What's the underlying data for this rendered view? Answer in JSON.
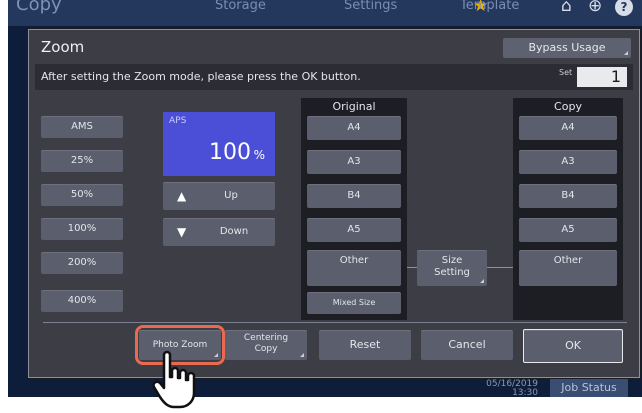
{
  "topbar": {
    "app_title": "Copy",
    "tabs": [
      "Storage",
      "Settings",
      "Template"
    ]
  },
  "dialog": {
    "title": "Zoom",
    "bypass_label": "Bypass Usage",
    "message": "After setting the Zoom mode, please press the OK button.",
    "set_label": "Set",
    "set_value": "1"
  },
  "zoom_buttons": [
    "AMS",
    "25%",
    "50%",
    "100%",
    "200%",
    "400%"
  ],
  "aps": {
    "label": "APS",
    "value": "100",
    "unit": "%"
  },
  "up_label": "Up",
  "down_label": "Down",
  "original": {
    "header": "Original",
    "items": [
      "A4",
      "A3",
      "B4",
      "A5",
      "Other",
      "Mixed Size"
    ]
  },
  "size_setting": {
    "line1": "Size",
    "line2": "Setting"
  },
  "copy": {
    "header": "Copy",
    "items": [
      "A4",
      "A3",
      "B4",
      "A5",
      "Other"
    ]
  },
  "bottom": {
    "photo_zoom": "Photo Zoom",
    "centering_line1": "Centering",
    "centering_line2": "Copy",
    "reset": "Reset",
    "cancel": "Cancel",
    "ok": "OK"
  },
  "status": {
    "date": "05/16/2019",
    "time": "13:30",
    "job_status": "Job Status"
  },
  "colors": {
    "highlight": "#e96a4e",
    "aps_panel": "#4b4fd8"
  }
}
